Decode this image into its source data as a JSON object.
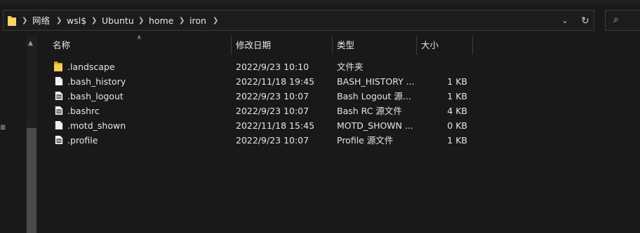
{
  "address": {
    "crumbs": [
      "网络",
      "wsl$",
      "Ubuntu",
      "home",
      "iron"
    ],
    "dropdown_icon": "chevron-down-icon",
    "refresh_icon": "refresh-icon"
  },
  "search": {
    "icon": "search-icon"
  },
  "columns": {
    "name": "名称",
    "date": "修改日期",
    "type": "类型",
    "size": "大小"
  },
  "files": [
    {
      "name": ".landscape",
      "date": "2022/9/23 10:10",
      "type": "文件夹",
      "size": "",
      "icon": "folder-icon"
    },
    {
      "name": ".bash_history",
      "date": "2022/11/18 19:45",
      "type": "BASH_HISTORY ...",
      "size": "1 KB",
      "icon": "file-icon"
    },
    {
      "name": ".bash_logout",
      "date": "2022/9/23 10:07",
      "type": "Bash Logout 源...",
      "size": "1 KB",
      "icon": "source-file-icon"
    },
    {
      "name": ".bashrc",
      "date": "2022/9/23 10:07",
      "type": "Bash RC 源文件",
      "size": "4 KB",
      "icon": "source-file-icon"
    },
    {
      "name": ".motd_shown",
      "date": "2022/11/18 15:45",
      "type": "MOTD_SHOWN ...",
      "size": "0 KB",
      "icon": "file-icon"
    },
    {
      "name": ".profile",
      "date": "2022/9/23 10:07",
      "type": "Profile 源文件",
      "size": "1 KB",
      "icon": "source-file-icon"
    }
  ],
  "colors": {
    "background": "#191919",
    "folder": "#f3c54a",
    "text": "#e6e6e6"
  }
}
